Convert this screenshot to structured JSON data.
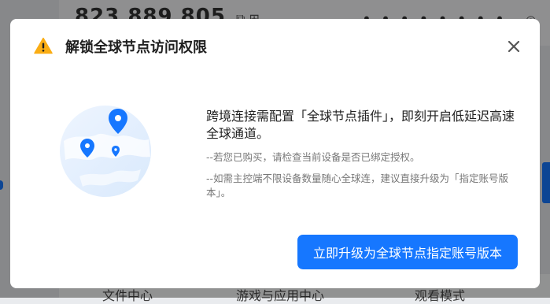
{
  "background": {
    "account_id": "823 889 805",
    "password_mask": "• • • • • • • •",
    "bottom_tabs": [
      "文件中心",
      "游戏与应用中心",
      "观看模式"
    ]
  },
  "modal": {
    "title": "解锁全球节点访问权限",
    "main_text": "跨境连接需配置「全球节点插件」，即刻开启低延迟高速全球通道。",
    "note_1": "--若您已购买，请检查当前设备是否已绑定授权。",
    "note_2": "--如需主控端不限设备数量随心全球连，建议直接升级为「指定账号版本」。",
    "upgrade_button": "立即升级为全球节点指定账号版本"
  },
  "colors": {
    "accent": "#1677ff",
    "warning": "#faad14",
    "overlay": "rgba(0,0,0,0.42)"
  },
  "icons": {
    "warning": "warning-triangle-icon",
    "close": "close-icon",
    "globe": "globe-pins-illustration"
  }
}
